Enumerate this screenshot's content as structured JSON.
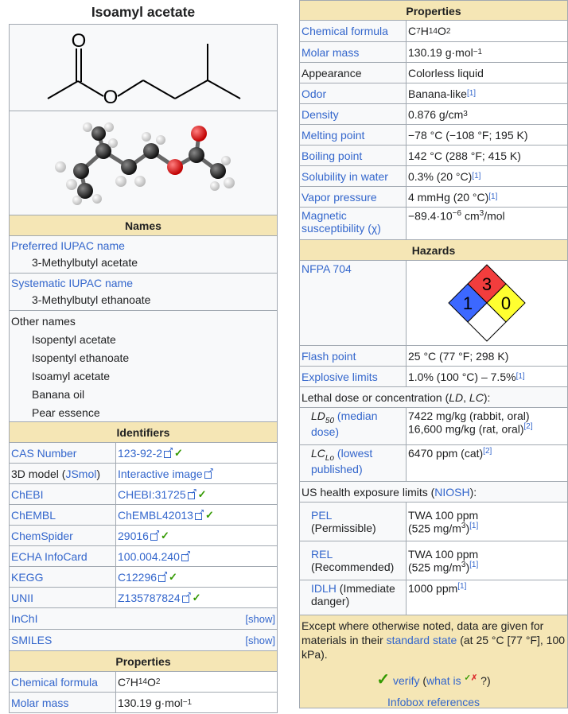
{
  "left": {
    "title": "Isoamyl acetate",
    "names_header": "Names",
    "preferred_label": "Preferred IUPAC name",
    "preferred_value": "3-Methylbutyl acetate",
    "systematic_label": "Systematic IUPAC name",
    "systematic_value": "3-Methylbutyl ethanoate",
    "other_label": "Other names",
    "other_names": [
      "Isopentyl acetate",
      "Isopentyl ethanoate",
      "Isoamyl acetate",
      "Banana oil",
      "Pear essence"
    ],
    "identifiers_header": "Identifiers",
    "cas_label": "CAS Number",
    "cas_value": "123-92-2",
    "model_label_a": "3D model (",
    "model_label_link": "JSmol",
    "model_label_b": ")",
    "model_value": "Interactive image",
    "chebi_label": "ChEBI",
    "chebi_value": "CHEBI:31725",
    "chembl_label": "ChEMBL",
    "chembl_value": "ChEMBL42013",
    "chemspider_label": "ChemSpider",
    "chemspider_value": "29016",
    "echa_label": "ECHA InfoCard",
    "echa_value": "100.004.240",
    "kegg_label": "KEGG",
    "kegg_value": "C12296",
    "unii_label": "UNII",
    "unii_value": "Z135787824",
    "inchi_label": "InChI",
    "smiles_label": "SMILES",
    "show": "[show]",
    "properties_header": "Properties",
    "formula_label": "Chemical formula",
    "molar_label": "Molar mass",
    "molar_value": "130.19 g·mol",
    "molar_sup": "−1",
    "atom_o": "O"
  },
  "right": {
    "properties_header": "Properties",
    "formula_label": "Chemical formula",
    "molar_label": "Molar mass",
    "molar_value": "130.19 g·mol",
    "molar_sup": "−1",
    "appearance_label": "Appearance",
    "appearance_value": "Colorless liquid",
    "odor_label": "Odor",
    "odor_value": "Banana-like",
    "odor_ref": "[1]",
    "density_label": "Density",
    "density_value": "0.876 g/cm",
    "density_sup": "3",
    "mp_label": "Melting point",
    "mp_value": "−78 °C (−108 °F; 195 K)",
    "bp_label": "Boiling point",
    "bp_value": "142 °C (288 °F; 415 K)",
    "sol_label": "Solubility in water",
    "sol_value": "0.3% (20 °C)",
    "sol_ref": "[1]",
    "vp_label": "Vapor pressure",
    "vp_value": "4 mmHg (20 °C)",
    "vp_ref": "[1]",
    "mag_label_a": "Magnetic",
    "mag_label_b": "susceptibility",
    "mag_label_c": "(χ)",
    "mag_value_a": "−89.4·10",
    "mag_value_sup": "−6",
    "mag_value_b": " cm",
    "mag_value_sup2": "3",
    "mag_value_c": "/mol",
    "hazards_header": "Hazards",
    "nfpa_label": "NFPA 704",
    "nfpa_health": "1",
    "nfpa_fire": "3",
    "nfpa_reactivity": "0",
    "flash_label": "Flash point",
    "flash_value": "25 °C (77 °F; 298 K)",
    "explosive_label": "Explosive limits",
    "explosive_value": "1.0% (100 °C) – 7.5%",
    "explosive_ref": "[1]",
    "lethal_a": "Lethal dose or concentration (",
    "lethal_ld": "LD",
    "lethal_sep": ", ",
    "lethal_lc": "LC",
    "lethal_b": "):",
    "ld50_a": "LD",
    "ld50_sub": "50",
    "ld50_link": "(median dose)",
    "ld50_v1": "7422 mg/kg (rabbit, oral)",
    "ld50_v2": "16,600 mg/kg (rat, oral)",
    "ld50_ref": "[2]",
    "lclo_a": "LC",
    "lclo_sub": "Lo",
    "lclo_link": "(lowest published)",
    "lclo_value": "6470 ppm (cat)",
    "lclo_ref": "[2]",
    "us_a": "US health exposure limits (",
    "us_link": "NIOSH",
    "us_b": "):",
    "pel_link": "PEL",
    "pel_desc": "(Permissible)",
    "pel_v1": "TWA 100 ppm",
    "pel_v2": "(525 mg/m",
    "pel_sup": "3",
    "pel_v3": ")",
    "pel_ref": "[1]",
    "rel_link": "REL",
    "rel_desc": "(Recommended)",
    "rel_v1": "TWA 100 ppm",
    "rel_v2": "(525 mg/m",
    "rel_sup": "3",
    "rel_v3": ")",
    "rel_ref": "[1]",
    "idlh_link": "IDLH",
    "idlh_desc": "(Immediate danger)",
    "idlh_value": "1000 ppm",
    "idlh_ref": "[1]",
    "note_a": "Except where otherwise noted, data are given for materials in their ",
    "note_link": "standard state",
    "note_b": " (at 25 °C [77 °F], 100 kPa).",
    "verify_check": "✓",
    "verify_link": "verify",
    "whatis_a": "(",
    "whatis_link": "what is",
    "whatis_check": "✓",
    "whatis_x": "✗",
    "whatis_b": " ?)",
    "infobox_refs": "Infobox references"
  },
  "colors": {
    "header_bg": "#f5e6b5",
    "cell_bg": "#f8f9fa",
    "border": "#a2a9b1",
    "link": "#3366cc",
    "check": "#339900",
    "nfpa_red": "#f23d3d",
    "nfpa_blue": "#3c68ff",
    "nfpa_yellow": "#ffff30"
  }
}
